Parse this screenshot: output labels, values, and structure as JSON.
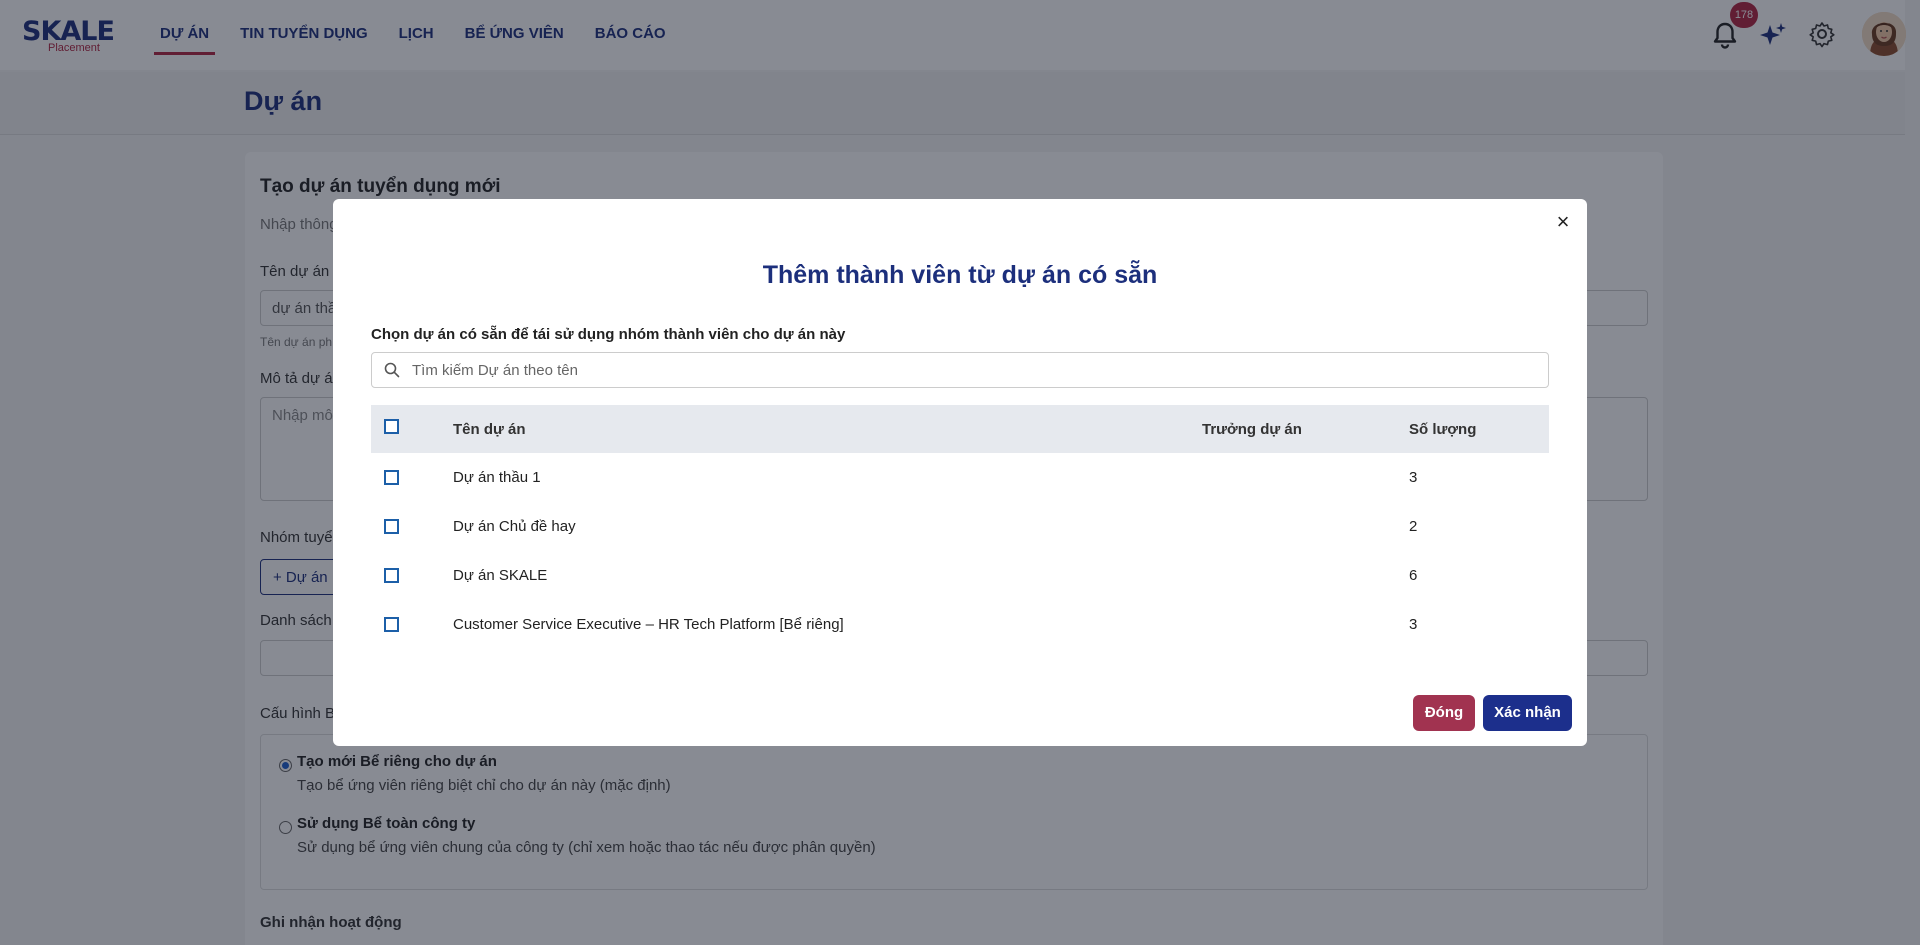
{
  "nav": {
    "logo_text": "SKALE",
    "logo_sub": "Placement",
    "items": [
      {
        "label": "DỰ ÁN"
      },
      {
        "label": "TIN TUYỂN DỤNG"
      },
      {
        "label": "LỊCH"
      },
      {
        "label": "BỂ ỨNG VIÊN"
      },
      {
        "label": "BÁO CÁO"
      }
    ],
    "active_index": 0,
    "notification_count": "178",
    "icons": [
      "bell-icon",
      "sparkle-icon",
      "gear-icon",
      "avatar"
    ]
  },
  "page": {
    "title": "Dự án"
  },
  "form": {
    "title": "Tạo dự án tuyển dụng mới",
    "subtitle": "Nhập thông",
    "name_label": "Tên dự án",
    "name_value": "dự án thầ",
    "name_hint": "Tên dự án ph",
    "desc_label": "Mô tả dự á",
    "desc_placeholder": "Nhập mô",
    "group_label": "Nhóm tuyể",
    "add_project_btn": "+ Dự án",
    "list_label": "Danh sách",
    "config_label": "Cấu hình B",
    "option1_title": "Tạo mới Bể riêng cho dự án",
    "option1_desc": "Tạo bể ứng viên riêng biệt chỉ cho dự án này (mặc định)",
    "option2_title": "Sử dụng Bể toàn công ty",
    "option2_desc": "Sử dụng bể ứng viên chung của công ty (chỉ xem hoặc thao tác nếu được phân quyền)",
    "activity_label": "Ghi nhận hoạt động"
  },
  "modal": {
    "close_glyph": "×",
    "title": "Thêm thành viên từ dự án có sẵn",
    "label": "Chọn dự án có sẵn để tái sử dụng nhóm thành viên cho dự án này",
    "search_placeholder": "Tìm kiếm Dự án theo tên",
    "columns": {
      "name": "Tên dự án",
      "lead": "Trưởng dự án",
      "qty": "Số lượng"
    },
    "rows": [
      {
        "name": "Dự án thầu 1",
        "lead": "",
        "qty": "3"
      },
      {
        "name": "Dự án Chủ đề hay",
        "lead": "",
        "qty": "2"
      },
      {
        "name": "Dự án SKALE",
        "lead": "",
        "qty": "6"
      },
      {
        "name": "Customer Service Executive – HR Tech Platform [Bể riêng]",
        "lead": "",
        "qty": "3"
      }
    ],
    "close_button": "Đóng",
    "confirm_button": "Xác nhận"
  },
  "colors": {
    "primary": "#1c2f7c",
    "accent": "#b02440",
    "close_button": "#a13350",
    "confirm_button": "#1c2f8c"
  }
}
